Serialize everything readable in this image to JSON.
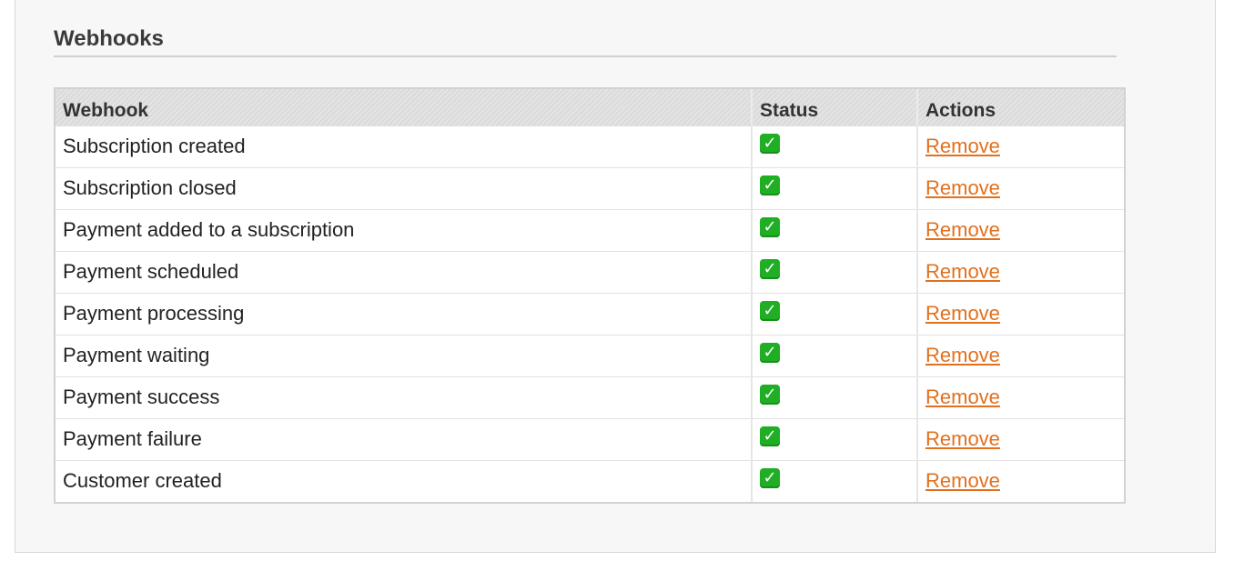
{
  "section": {
    "title": "Webhooks"
  },
  "table": {
    "headers": {
      "webhook": "Webhook",
      "status": "Status",
      "actions": "Actions"
    },
    "rows": [
      {
        "webhook": "Subscription created",
        "status_icon": "check-mark-icon",
        "action": "Remove"
      },
      {
        "webhook": "Subscription closed",
        "status_icon": "check-mark-icon",
        "action": "Remove"
      },
      {
        "webhook": "Payment added to a subscription",
        "status_icon": "check-mark-icon",
        "action": "Remove"
      },
      {
        "webhook": "Payment scheduled",
        "status_icon": "check-mark-icon",
        "action": "Remove"
      },
      {
        "webhook": "Payment processing",
        "status_icon": "check-mark-icon",
        "action": "Remove"
      },
      {
        "webhook": "Payment waiting",
        "status_icon": "check-mark-icon",
        "action": "Remove"
      },
      {
        "webhook": "Payment success",
        "status_icon": "check-mark-icon",
        "action": "Remove"
      },
      {
        "webhook": "Payment failure",
        "status_icon": "check-mark-icon",
        "action": "Remove"
      },
      {
        "webhook": "Customer created",
        "status_icon": "check-mark-icon",
        "action": "Remove"
      }
    ]
  },
  "colors": {
    "link": "#e2701c",
    "check": "#1fae24",
    "panel_bg": "#f7f7f7"
  }
}
